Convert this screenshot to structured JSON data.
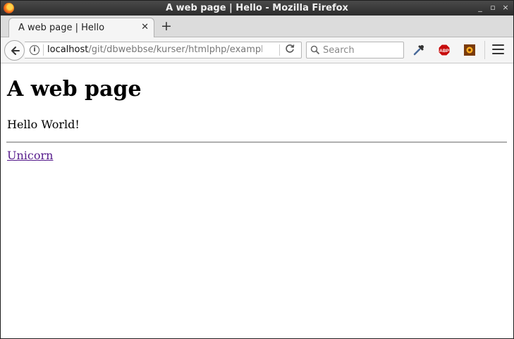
{
  "window": {
    "title": "A web page | Hello - Mozilla Firefox",
    "controls": [
      "_",
      "▫",
      "×"
    ]
  },
  "tabs": [
    {
      "label": "A web page | Hello",
      "active": true
    }
  ],
  "navbar": {
    "url_host": "localhost",
    "url_path": "/git/dbwebbse/kurser/htmlphp/example/",
    "search_placeholder": "Search",
    "icons": [
      "back-arrow-icon",
      "info-icon",
      "reload-icon",
      "search-icon",
      "eyedropper-icon",
      "adblock-plus-icon",
      "extension-icon",
      "hamburger-menu-icon"
    ],
    "abp_text": "ABP"
  },
  "page": {
    "heading": "A web page",
    "paragraph": "Hello World!",
    "link_text": "Unicorn",
    "link_color": "#551a8b"
  }
}
